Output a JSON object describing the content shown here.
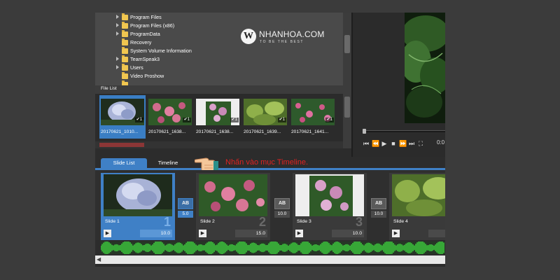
{
  "folder_tree": {
    "items": [
      {
        "label": "Program Files",
        "expandable": true
      },
      {
        "label": "Program Files (x86)",
        "expandable": true
      },
      {
        "label": "ProgramData",
        "expandable": true
      },
      {
        "label": "Recovery",
        "expandable": false
      },
      {
        "label": "System Volume Information",
        "expandable": false
      },
      {
        "label": "TeamSpeak3",
        "expandable": true
      },
      {
        "label": "Users",
        "expandable": true
      },
      {
        "label": "Video Proshow",
        "expandable": false
      }
    ]
  },
  "logo": {
    "letter": "W",
    "brand": "NHANHOA.COM",
    "tagline": "TO BE THE BEST"
  },
  "file_list": {
    "title": "File List",
    "files": [
      {
        "name": "20170621_1010...",
        "badge": "1",
        "selected": true
      },
      {
        "name": "20170621_1638...",
        "badge": "1",
        "selected": false
      },
      {
        "name": "20170621_1638...",
        "badge": "1",
        "selected": false
      },
      {
        "name": "20170621_1639...",
        "badge": "1",
        "selected": false
      },
      {
        "name": "20170621_1641...",
        "badge": "1",
        "selected": false
      }
    ]
  },
  "preview": {
    "time": "0:0"
  },
  "tabs": {
    "slide_list": "Slide List",
    "timeline": "Timeline"
  },
  "instruction": "Nhấn vào mục Timeline.",
  "slides": [
    {
      "label": "Slide 1",
      "number": "1",
      "duration": "10.0",
      "selected": true
    },
    {
      "label": "Slide 2",
      "number": "2",
      "duration": "15.0",
      "selected": false
    },
    {
      "label": "Slide 3",
      "number": "3",
      "duration": "10.0",
      "selected": false
    },
    {
      "label": "Slide 4",
      "number": "4",
      "duration": "",
      "selected": false
    }
  ],
  "transitions": [
    {
      "icon": "AB",
      "duration": "5.0",
      "selected": true
    },
    {
      "icon": "AB",
      "duration": "10.0",
      "selected": false
    },
    {
      "icon": "AB",
      "duration": "10.0",
      "selected": false
    }
  ],
  "colors": {
    "accent": "#3f80c6",
    "instruction": "#e02222",
    "waveform": "#3fd83f",
    "folder": "#f0c650"
  }
}
